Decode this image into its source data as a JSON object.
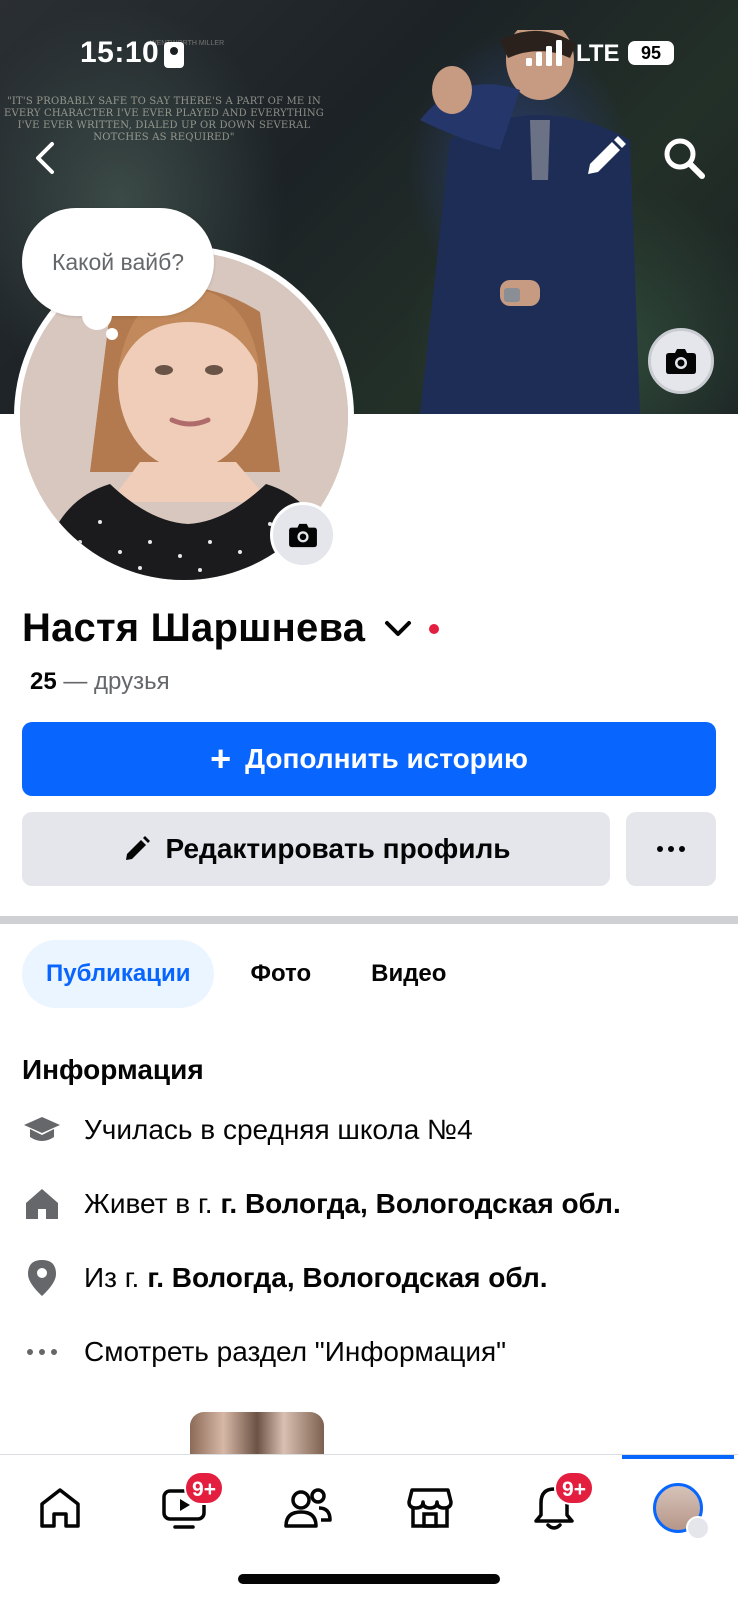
{
  "status_bar": {
    "time": "15:10",
    "network": "LTE",
    "battery": "95"
  },
  "cover": {
    "quote": "\"IT'S PROBABLY SAFE TO SAY THERE'S A PART OF ME IN EVERY CHARACTER I'VE EVER PLAYED AND EVERYTHING I'VE EVER WRITTEN, DIALED UP OR DOWN SEVERAL NOTCHES AS REQUIRED\"",
    "credit": "WENTWORTH MILLER"
  },
  "bubble": {
    "text": "Какой вайб?"
  },
  "profile": {
    "name": "Настя Шаршнева",
    "friends_count": "25",
    "friends_label": "— друзья"
  },
  "actions": {
    "primary_label": "Дополнить историю",
    "edit_label": "Редактировать профиль"
  },
  "tabs": [
    {
      "label": "Публикации",
      "active": true
    },
    {
      "label": "Фото",
      "active": false
    },
    {
      "label": "Видео",
      "active": false
    }
  ],
  "info": {
    "title": "Информация",
    "rows": [
      {
        "icon": "graduation-cap-icon",
        "text": "Училась в средняя школа №4",
        "bold": ""
      },
      {
        "icon": "home-icon",
        "text": "Живет в г.",
        "bold": "г. Вологда, Вологодская обл."
      },
      {
        "icon": "location-pin-icon",
        "text": "Из г.",
        "bold": "г. Вологда, Вологодская обл."
      },
      {
        "icon": "more-dots-icon",
        "text": "Смотреть раздел \"Информация\"",
        "bold": ""
      }
    ]
  },
  "bottom_nav": {
    "items": [
      {
        "name": "home",
        "icon": "home-icon"
      },
      {
        "name": "video",
        "icon": "video-icon",
        "badge": "9+"
      },
      {
        "name": "friends",
        "icon": "friends-icon"
      },
      {
        "name": "marketplace",
        "icon": "marketplace-icon"
      },
      {
        "name": "notifications",
        "icon": "bell-icon",
        "badge": "9+"
      },
      {
        "name": "profile",
        "icon": "avatar",
        "active": true
      }
    ]
  },
  "colors": {
    "accent": "#0866ff",
    "badge": "#e41e3f",
    "secondary_button": "#e4e6eb",
    "muted_text": "#65676b"
  }
}
